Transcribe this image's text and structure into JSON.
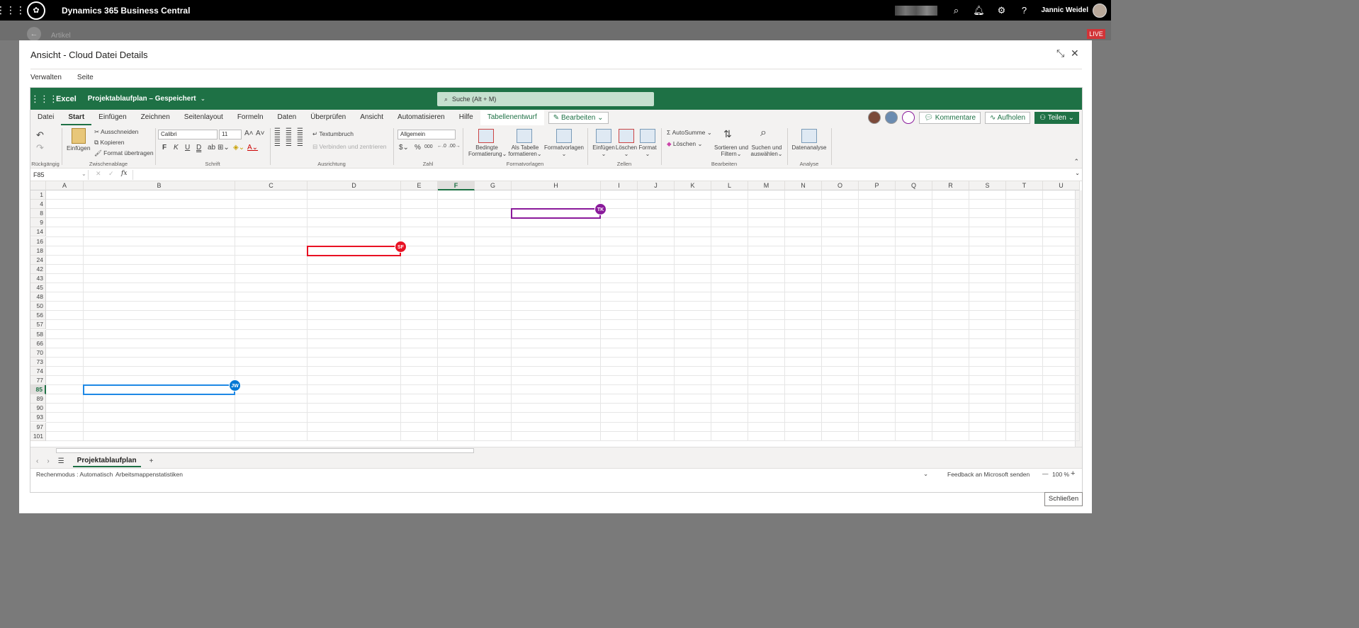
{
  "app": {
    "title": "Dynamics 365 Business Central",
    "user": "Jannic Weidel",
    "live": "LIVE"
  },
  "background": {
    "breadcrumb": "Artikel"
  },
  "dialog": {
    "title": "Ansicht - Cloud Datei Details",
    "menu": [
      "Verwalten",
      "Seite"
    ],
    "close_button": "Schließen"
  },
  "excel": {
    "app_name": "Excel",
    "file": "Projektablaufplan – Gespeichert",
    "search_placeholder": "Suche (Alt + M)",
    "tabs": [
      "Datei",
      "Start",
      "Einfügen",
      "Zeichnen",
      "Seitenlayout",
      "Formeln",
      "Daten",
      "Überprüfen",
      "Ansicht",
      "Automatisieren",
      "Hilfe",
      "Tabellenentwurf"
    ],
    "active_tab": "Start",
    "edit_mode": "Bearbeiten",
    "comments": "Kommentare",
    "catch_up": "Aufholen",
    "share": "Teilen",
    "ribbon": {
      "groups": [
        "Rückgängig",
        "Zwischenablage",
        "Schrift",
        "Ausrichtung",
        "Zahl",
        "Formatvorlagen",
        "Zellen",
        "Bearbeiten",
        "Analyse"
      ],
      "paste": "Einfügen",
      "cut": "Ausschneiden",
      "copy": "Kopieren",
      "format_painter": "Format übertragen",
      "font": "Calibri",
      "font_size": "11",
      "bold": "F",
      "italic": "K",
      "underline": "U",
      "double_underline": "D",
      "wrap": "Textumbruch",
      "merge": "Verbinden und zentrieren",
      "number_format": "Allgemein",
      "cond_format_1": "Bedingte",
      "cond_format_2": "Formatierung",
      "as_table_1": "Als Tabelle",
      "as_table_2": "formatieren",
      "cell_styles": "Formatvorlagen",
      "insert": "Einfügen",
      "delete": "Löschen",
      "format": "Format",
      "autosum": "AutoSumme",
      "clear": "Löschen",
      "sort_1": "Sortieren und",
      "sort_2": "Filtern",
      "find_1": "Suchen und",
      "find_2": "auswählen",
      "data_analysis": "Datenanalyse"
    },
    "name_box": "F85",
    "columns": [
      "A",
      "B",
      "C",
      "D",
      "E",
      "F",
      "G",
      "H",
      "I",
      "J",
      "K",
      "L",
      "M",
      "N",
      "O",
      "P",
      "Q",
      "R",
      "S",
      "T",
      "U"
    ],
    "selected_column": "F",
    "rows": [
      "1",
      "4",
      "8",
      "9",
      "14",
      "16",
      "18",
      "24",
      "42",
      "43",
      "45",
      "48",
      "50",
      "56",
      "57",
      "58",
      "66",
      "70",
      "73",
      "74",
      "77",
      "85",
      "89",
      "90",
      "93",
      "97",
      "101"
    ],
    "selected_row": "85",
    "presence": [
      {
        "initials": "TK",
        "color": "#8a1a9b"
      },
      {
        "initials": "SF",
        "color": "#e81123"
      },
      {
        "initials": "JW",
        "color": "#0078d4"
      }
    ],
    "sheet_tab": "Projektablaufplan",
    "status": {
      "calc_mode": "Rechenmodus : Automatisch",
      "workbook_stats": "Arbeitsmappenstatistiken",
      "feedback": "Feedback an Microsoft senden",
      "zoom": "100 %"
    }
  }
}
